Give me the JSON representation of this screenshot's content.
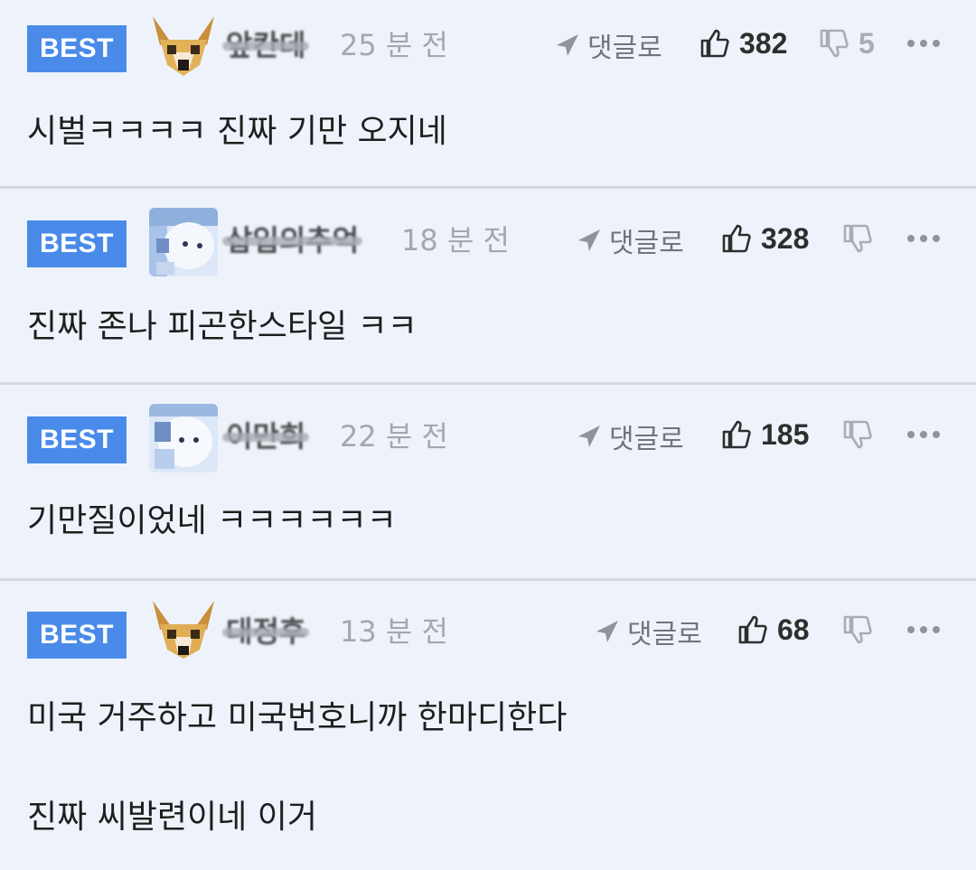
{
  "comments": [
    {
      "badge": "BEST",
      "nickname": "앞칸데",
      "time": "25 분 전",
      "reply_label": "댓글로",
      "likes": "382",
      "dislikes": "5",
      "lines": [
        "시벌ㅋㅋㅋㅋ 진짜 기만 오지네"
      ]
    },
    {
      "badge": "BEST",
      "nickname": "삽입의추억",
      "time": "18 분 전",
      "reply_label": "댓글로",
      "likes": "328",
      "dislikes": "",
      "lines": [
        "진짜 존나 피곤한스타일 ㅋㅋ"
      ]
    },
    {
      "badge": "BEST",
      "nickname": "이만희",
      "time": "22 분 전",
      "reply_label": "댓글로",
      "likes": "185",
      "dislikes": "",
      "lines": [
        "기만질이었네 ㅋㅋㅋㅋㅋㅋ"
      ]
    },
    {
      "badge": "BEST",
      "nickname": "대정후",
      "time": "13 분 전",
      "reply_label": "댓글로",
      "likes": "68",
      "dislikes": "",
      "lines": [
        "미국 거주하고 미국번호니까 한마디한다",
        "진짜 씨발련이네 이거"
      ]
    }
  ],
  "icons": {
    "reply": "reply-arrow-icon",
    "like": "thumbs-up-icon",
    "dislike": "thumbs-down-icon",
    "more": "more-dots-icon"
  },
  "colors": {
    "background": "#eef3fb",
    "badge": "#4a8bea",
    "divider": "#d3d8df",
    "muted": "#a3a8ae"
  }
}
